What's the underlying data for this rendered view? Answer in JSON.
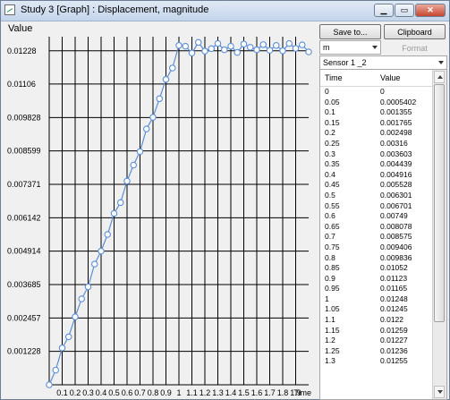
{
  "window": {
    "title": "Study 3  [Graph] : Displacement, magnitude",
    "minimize": "▁",
    "maximize": "▭",
    "close": "✕"
  },
  "panel": {
    "save_label": "Save to...",
    "clipboard_label": "Clipboard",
    "unit_value": "m",
    "format_label": "Format",
    "sensor_value": "Sensor 1 _2"
  },
  "table": {
    "headers": [
      "Time",
      "Value"
    ],
    "rows": [
      [
        "0",
        "0"
      ],
      [
        "0.05",
        "0.0005402"
      ],
      [
        "0.1",
        "0.001355"
      ],
      [
        "0.15",
        "0.001765"
      ],
      [
        "0.2",
        "0.002498"
      ],
      [
        "0.25",
        "0.00316"
      ],
      [
        "0.3",
        "0.003603"
      ],
      [
        "0.35",
        "0.004439"
      ],
      [
        "0.4",
        "0.004916"
      ],
      [
        "0.45",
        "0.005528"
      ],
      [
        "0.5",
        "0.006301"
      ],
      [
        "0.55",
        "0.006701"
      ],
      [
        "0.6",
        "0.00749"
      ],
      [
        "0.65",
        "0.008078"
      ],
      [
        "0.7",
        "0.008575"
      ],
      [
        "0.75",
        "0.009406"
      ],
      [
        "0.8",
        "0.009836"
      ],
      [
        "0.85",
        "0.01052"
      ],
      [
        "0.9",
        "0.01123"
      ],
      [
        "0.95",
        "0.01165"
      ],
      [
        "1",
        "0.01248"
      ],
      [
        "1.05",
        "0.01245"
      ],
      [
        "1.1",
        "0.0122"
      ],
      [
        "1.15",
        "0.01259"
      ],
      [
        "1.2",
        "0.01227"
      ],
      [
        "1.25",
        "0.01236"
      ],
      [
        "1.3",
        "0.01255"
      ]
    ]
  },
  "chart_data": {
    "type": "line",
    "ylabel": "Value",
    "xlabel": "Time",
    "yticks": [
      "0.001228",
      "0.002457",
      "0.003685",
      "0.004914",
      "0.006142",
      "0.007371",
      "0.008599",
      "0.009828",
      "0.01106",
      "0.01228"
    ],
    "ytick_values": [
      0.001228,
      0.002457,
      0.003685,
      0.004914,
      0.006142,
      0.007371,
      0.008599,
      0.009828,
      0.01106,
      0.01228
    ],
    "xticks": [
      "0.1",
      "0.2",
      "0.3",
      "0.4",
      "0.5",
      "0.6",
      "0.7",
      "0.8",
      "0.9",
      "1",
      "1.1",
      "1.2",
      "1.3",
      "1.4",
      "1.5",
      "1.6",
      "1.7",
      "1.8",
      "1.9"
    ],
    "xtick_values": [
      0.1,
      0.2,
      0.3,
      0.4,
      0.5,
      0.6,
      0.7,
      0.8,
      0.9,
      1.0,
      1.1,
      1.2,
      1.3,
      1.4,
      1.5,
      1.6,
      1.7,
      1.8,
      1.9
    ],
    "xlim": [
      0,
      2.0
    ],
    "ylim": [
      0,
      0.0128
    ],
    "grid": true,
    "line_color": "#5b8fd6",
    "x": [
      0,
      0.05,
      0.1,
      0.15,
      0.2,
      0.25,
      0.3,
      0.35,
      0.4,
      0.45,
      0.5,
      0.55,
      0.6,
      0.65,
      0.7,
      0.75,
      0.8,
      0.85,
      0.9,
      0.95,
      1.0,
      1.05,
      1.1,
      1.15,
      1.2,
      1.25,
      1.3,
      1.35,
      1.4,
      1.45,
      1.5,
      1.55,
      1.6,
      1.65,
      1.7,
      1.75,
      1.8,
      1.85,
      1.9,
      1.95,
      2.0
    ],
    "y": [
      0,
      0.0005402,
      0.001355,
      0.001765,
      0.002498,
      0.00316,
      0.003603,
      0.004439,
      0.004916,
      0.005528,
      0.006301,
      0.006701,
      0.00749,
      0.008078,
      0.008575,
      0.009406,
      0.009836,
      0.01052,
      0.01123,
      0.01165,
      0.01248,
      0.01245,
      0.0122,
      0.01259,
      0.01227,
      0.01236,
      0.01255,
      0.01232,
      0.01245,
      0.01222,
      0.01253,
      0.01241,
      0.01232,
      0.01251,
      0.0123,
      0.01248,
      0.01228,
      0.01255,
      0.01237,
      0.0125,
      0.01224
    ]
  }
}
